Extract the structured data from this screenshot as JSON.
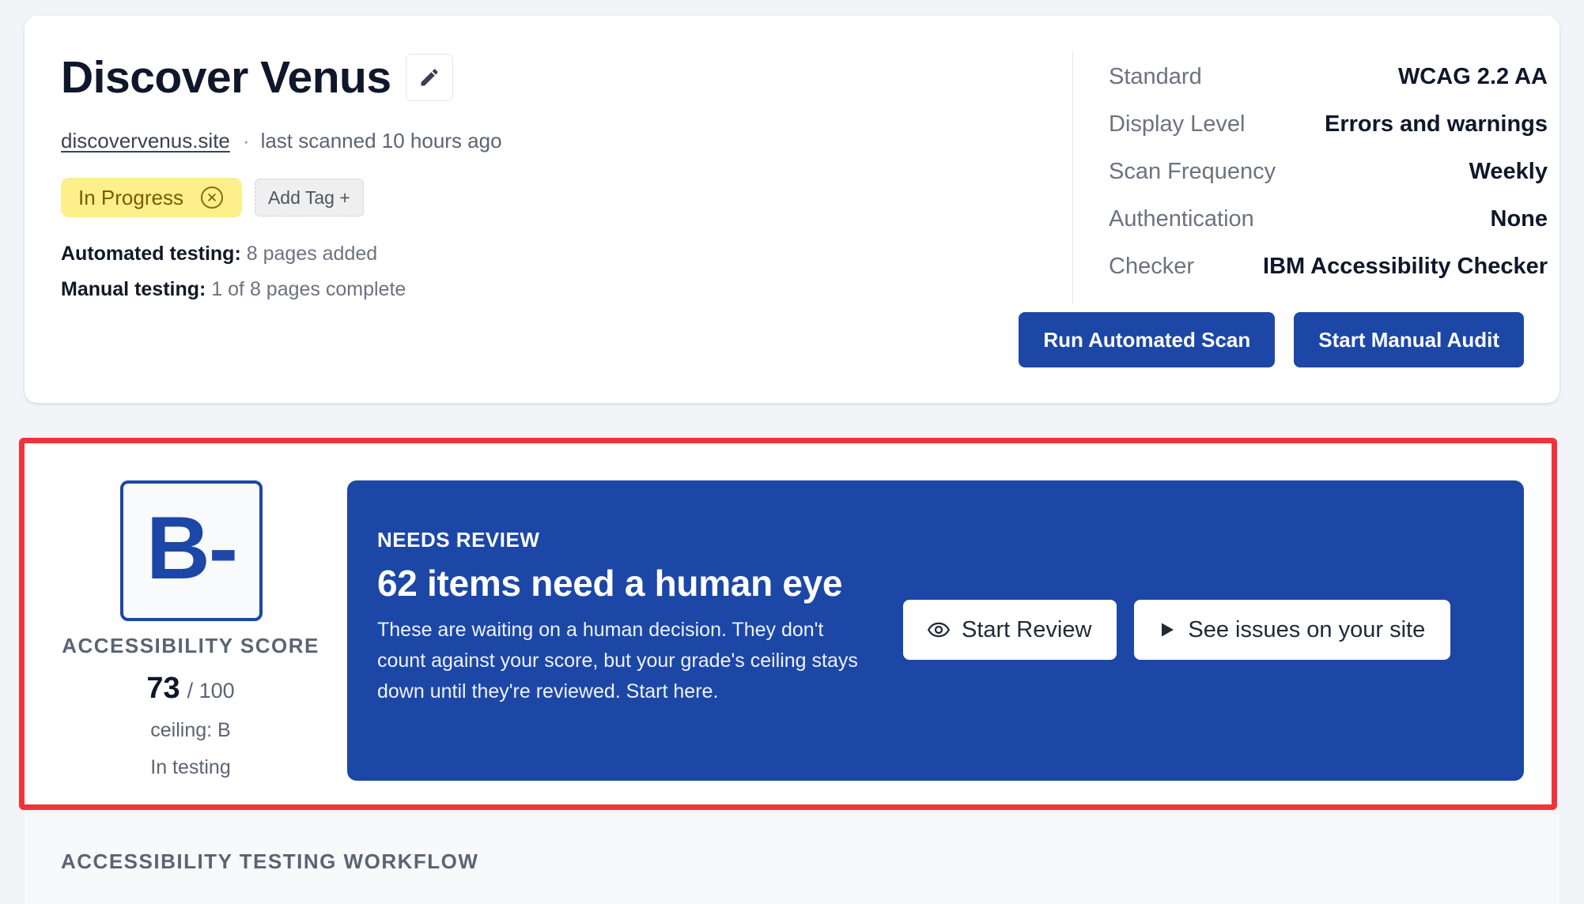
{
  "project": {
    "title": "Discover Venus",
    "url": "discovervenus.site",
    "last_scanned": "last scanned 10 hours ago",
    "status": "In Progress",
    "add_tag_label": "Add Tag +",
    "automated_label": "Automated testing:",
    "automated_value": "8 pages added",
    "manual_label": "Manual testing:",
    "manual_value": "1 of 8 pages complete"
  },
  "settings": [
    {
      "label": "Standard",
      "value": "WCAG 2.2 AA"
    },
    {
      "label": "Display Level",
      "value": "Errors and warnings"
    },
    {
      "label": "Scan Frequency",
      "value": "Weekly"
    },
    {
      "label": "Authentication",
      "value": "None"
    },
    {
      "label": "Checker",
      "value": "IBM Accessibility Checker"
    }
  ],
  "actions": {
    "run_scan": "Run Automated Scan",
    "start_audit": "Start Manual Audit"
  },
  "score": {
    "grade": "B-",
    "heading": "ACCESSIBILITY SCORE",
    "value": "73",
    "max": "/ 100",
    "ceiling": "ceiling: B",
    "stage": "In testing"
  },
  "review": {
    "eyebrow": "NEEDS REVIEW",
    "title": "62 items need a human eye",
    "description": "These are waiting on a human decision. They don't count against your score, but your grade's ceiling stays down until they're reviewed. Start here.",
    "start_review": "Start Review",
    "see_issues": "See issues on your site"
  },
  "workflow": {
    "heading": "ACCESSIBILITY TESTING WORKFLOW"
  },
  "icons": {
    "edit": "pencil-icon",
    "remove": "close-circle-icon",
    "review": "eye-icon",
    "play": "play-icon"
  },
  "colors": {
    "brand_blue": "#1c47a6",
    "status_yellow": "#fdf08a",
    "highlight_red": "#f0333b"
  }
}
